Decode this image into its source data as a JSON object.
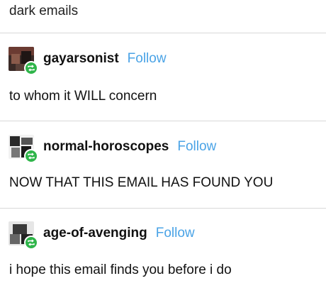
{
  "intro_text": "dark emails",
  "posts": [
    {
      "username": "gayarsonist",
      "follow_label": "Follow",
      "body": "to whom it WILL concern"
    },
    {
      "username": "normal-horoscopes",
      "follow_label": "Follow",
      "body": "NOW THAT THIS EMAIL HAS FOUND YOU"
    },
    {
      "username": "age-of-avenging",
      "follow_label": "Follow",
      "body": "i hope this email finds you before i do"
    }
  ],
  "colors": {
    "follow": "#4aa3e6",
    "reblog_badge": "#2fb54a",
    "divider": "#d9d9d9"
  },
  "icons": {
    "reblog": "reblog-icon",
    "avatar": "avatar"
  }
}
